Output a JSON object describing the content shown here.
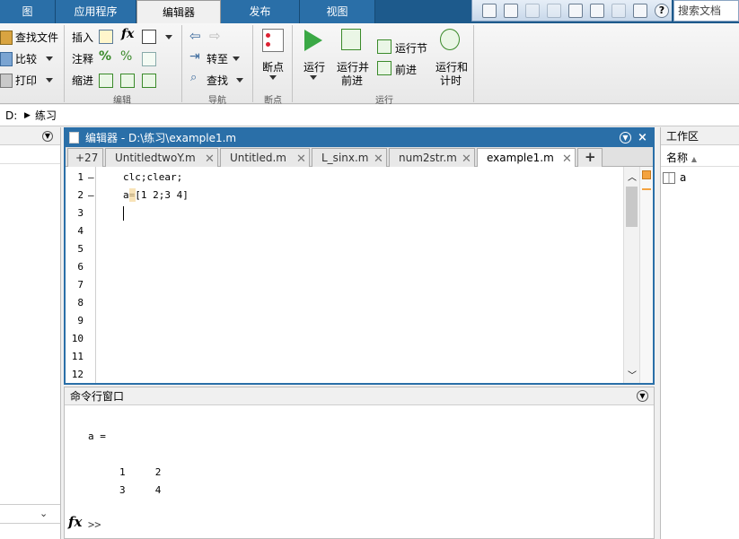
{
  "ribbon_tabs": [
    "图",
    "应用程序",
    "编辑器",
    "发布",
    "视图"
  ],
  "search": {
    "placeholder": "搜索文档"
  },
  "ribbon": {
    "file": {
      "find_files": "查找文件",
      "compare": "比较",
      "print": "打印"
    },
    "edit": {
      "insert": "插入",
      "comment": "注释",
      "indent": "缩进",
      "fx": "fx",
      "section_label": "编辑"
    },
    "navigate": {
      "goto": "转至",
      "find": "查找",
      "section_label": "导航"
    },
    "breakpoints": {
      "label": "断点",
      "section_label": "断点"
    },
    "run": {
      "run": "运行",
      "run_advance_1": "运行并",
      "run_advance_2": "前进",
      "run_section": "运行节",
      "advance": "前进",
      "run_time_1": "运行和",
      "run_time_2": "计时",
      "section_label": "运行"
    }
  },
  "address": {
    "drive": "D:",
    "folder": "练习"
  },
  "editor": {
    "title": "编辑器 - D:\\练习\\example1.m",
    "more_tabs": "+27",
    "tabs": [
      "UntitledtwoY.m",
      "Untitled.m",
      "L_sinx.m",
      "num2str.m",
      "example1.m"
    ],
    "active_tab": "example1.m",
    "line_numbers": [
      "1",
      "2",
      "3",
      "4",
      "5",
      "6",
      "7",
      "8",
      "9",
      "10",
      "11",
      "12"
    ],
    "lines": [
      "clc;clear;",
      "a=[1 2;3 4]",
      "",
      "",
      "",
      "",
      "",
      "",
      "",
      "",
      "",
      ""
    ],
    "line_markers": [
      "–",
      "–"
    ]
  },
  "command_window": {
    "title": "命令行窗口",
    "output_var": "a =",
    "matrix_row1": "1     2",
    "matrix_row2": "3     4",
    "prompt": ">>",
    "fx_label": "fx"
  },
  "workspace": {
    "title": "工作区",
    "column_name": "名称",
    "sort_indicator": "▲",
    "variables": [
      "a"
    ]
  }
}
